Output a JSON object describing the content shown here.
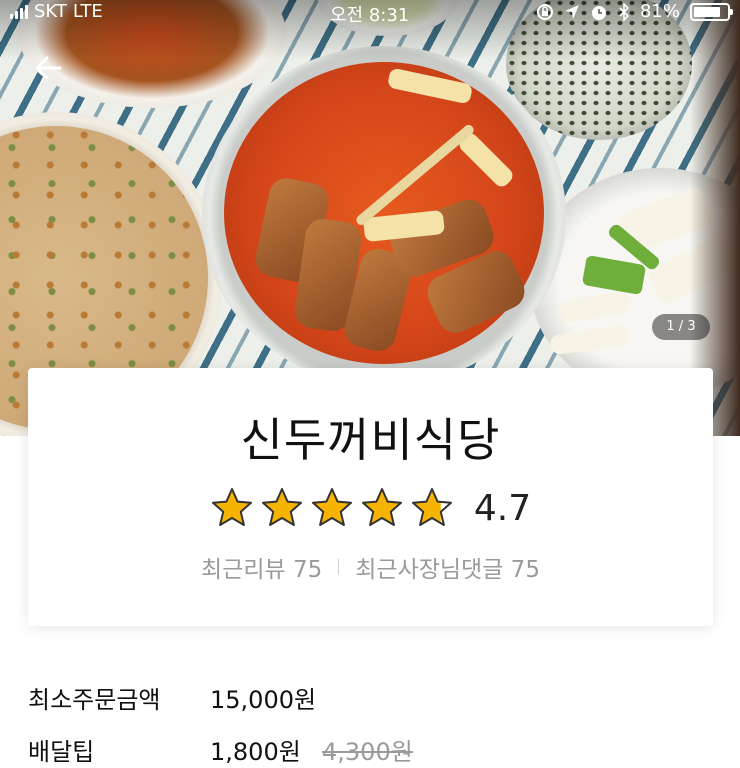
{
  "status_bar": {
    "carrier": "SKT",
    "network": "LTE",
    "time": "오전 8:31",
    "battery_percent": "81%",
    "battery_level": 0.81
  },
  "hero": {
    "page_indicator": "1 / 3",
    "current_page": 1,
    "total_pages": 3
  },
  "restaurant": {
    "name": "신두꺼비식당",
    "rating": "4.7",
    "rating_stars": 4.7,
    "recent_reviews_label": "최근리뷰 75",
    "recent_owner_replies_label": "최근사장님댓글 75"
  },
  "details": {
    "min_order_label": "최소주문금액",
    "min_order_value": "15,000원",
    "delivery_tip_label": "배달팁",
    "delivery_tip_value": "1,800원",
    "delivery_tip_original": "4,300원"
  },
  "colors": {
    "star": "#f6b400",
    "star_outline": "#333333",
    "muted_text": "#9a9a9a"
  },
  "icons": [
    "signal-icon",
    "lock-rotation-icon",
    "location-icon",
    "alarm-icon",
    "bluetooth-icon",
    "battery-icon",
    "back-arrow-icon",
    "star-icon"
  ]
}
